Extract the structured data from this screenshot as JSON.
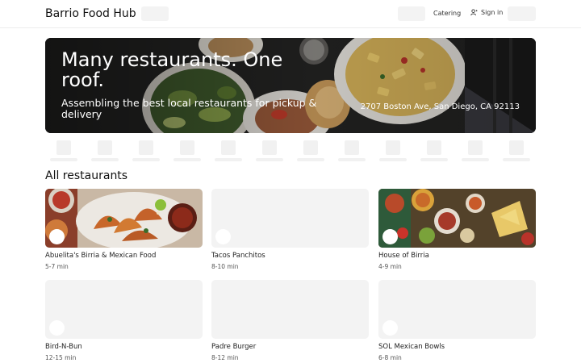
{
  "header": {
    "brand": "Barrio Food Hub",
    "nav": {
      "catering": "Catering",
      "sign_in": "Sign in",
      "sign_in_icon": "user-icon"
    }
  },
  "hero": {
    "title": "Many restaurants. One roof.",
    "subtitle": "Assembling the best local restaurants for pickup & delivery",
    "address": "2707 Boston Ave, San Diego, CA 92113"
  },
  "section": {
    "title": "All restaurants"
  },
  "restaurants": [
    {
      "name": "Abuelita's Birria & Mexican Food",
      "time": "5-7 min"
    },
    {
      "name": "Tacos Panchitos",
      "time": "8-10 min"
    },
    {
      "name": "House of Birria",
      "time": "4-9 min"
    },
    {
      "name": "Bird-N-Bun",
      "time": "12-15 min"
    },
    {
      "name": "Padre Burger",
      "time": "8-12 min"
    },
    {
      "name": "SOL Mexican Bowls",
      "time": "6-8 min"
    }
  ],
  "colors": {
    "placeholder": "#f3f3f3",
    "text": "#1a1a1a",
    "border": "#ececec"
  }
}
